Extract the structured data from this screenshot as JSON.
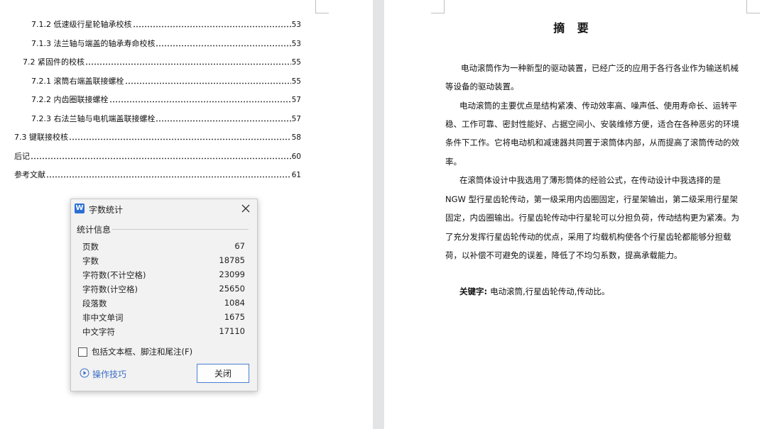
{
  "toc": [
    {
      "title": "7.1.2 低速级行星轮轴承校核",
      "page": "53"
    },
    {
      "title": "7.1.3 法兰轴与端盖的轴承寿命校核",
      "page": "53"
    },
    {
      "title": "7.2 紧固件的校核",
      "page": "55"
    },
    {
      "title": "7.2.1 滚筒右端盖联接螺栓",
      "page": "55"
    },
    {
      "title": "7.2.2 内齿圈联接螺栓",
      "page": "57"
    },
    {
      "title": "7.2.3 右法兰轴与电机端盖联接螺栓",
      "page": "57"
    },
    {
      "title": "7.3 键联接校核",
      "page": "58"
    },
    {
      "title": "后记",
      "page": "60"
    },
    {
      "title": "参考文献",
      "page": "61"
    }
  ],
  "dialog": {
    "logo": "W",
    "title": "字数统计",
    "section_label": "统计信息",
    "stats": [
      {
        "label": "页数",
        "value": "67"
      },
      {
        "label": "字数",
        "value": "18785"
      },
      {
        "label": "字符数(不计空格)",
        "value": "23099"
      },
      {
        "label": "字符数(计空格)",
        "value": "25650"
      },
      {
        "label": "段落数",
        "value": "1084"
      },
      {
        "label": "非中文单词",
        "value": "1675"
      },
      {
        "label": "中文字符",
        "value": "17110"
      }
    ],
    "checkbox_label": "包括文本框、脚注和尾注(F)",
    "tips_label": "操作技巧",
    "close_label": "关闭"
  },
  "abstract": {
    "title": "摘 要",
    "lines": [
      "电动滚筒作为一种新型的驱动装置，已经广泛的应用于各行各业作为输送机械",
      "等设备的驱动装置。",
      "电动滚筒的主要优点是结构紧凑、传动效率高、噪声低、使用寿命长、运转平",
      "稳、工作可靠、密封性能好、占据空间小、安装维修方便，适合在各种恶劣的环境",
      "条件下工作。它将电动机和减速器共同置于滚筒体内部，从而提高了滚筒传动的效",
      "率。",
      "在滚筒体设计中我选用了薄形筒体的经验公式，在传动设计中我选择的是",
      "NGW 型行星齿轮传动，第一级采用内齿圈固定，行星架输出，第二级采用行星架",
      "固定，内齿圈输出。行星齿轮传动中行星轮可以分担负荷，传动结构更为紧凑。为",
      "了充分发挥行星齿轮传动的优点，采用了均载机构使各个行星齿轮都能够分担载",
      "荷，以补偿不可避免的误差，降低了不均匀系数，提高承载能力。"
    ],
    "keywords_label": "关键字:",
    "keywords": "电动滚筒,行星齿轮传动,传动比。"
  }
}
